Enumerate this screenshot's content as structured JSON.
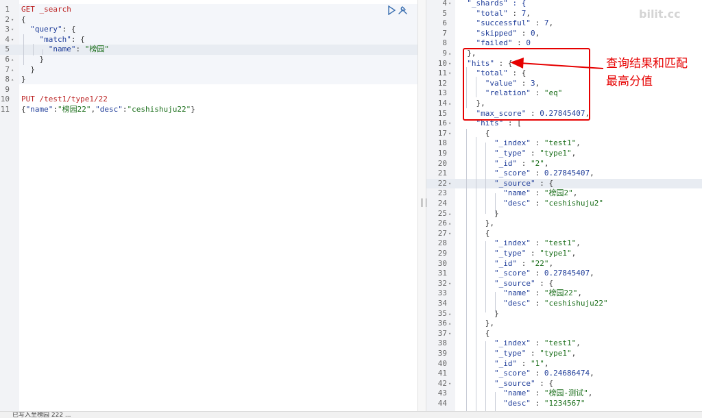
{
  "request_editor": {
    "lines": [
      {
        "n": "1",
        "fold": "",
        "segs": [
          [
            "GET _search",
            "kw"
          ]
        ]
      },
      {
        "n": "2",
        "fold": "▾",
        "segs": [
          [
            "{",
            "pun"
          ]
        ]
      },
      {
        "n": "3",
        "fold": "▾",
        "segs": [
          [
            "  ",
            "pun"
          ],
          [
            "\"query\"",
            "key"
          ],
          [
            ": {",
            "pun"
          ]
        ]
      },
      {
        "n": "4",
        "fold": "▾",
        "segs": [
          [
            "    ",
            "pun"
          ],
          [
            "\"match\"",
            "key"
          ],
          [
            ": {",
            "pun"
          ]
        ]
      },
      {
        "n": "5",
        "fold": "",
        "segs": [
          [
            "      ",
            "pun"
          ],
          [
            "\"name\"",
            "key"
          ],
          [
            ": ",
            "pun"
          ],
          [
            "\"榜园\"",
            "str"
          ]
        ]
      },
      {
        "n": "6",
        "fold": "▴",
        "segs": [
          [
            "    }",
            "pun"
          ]
        ]
      },
      {
        "n": "7",
        "fold": "▴",
        "segs": [
          [
            "  }",
            "pun"
          ]
        ]
      },
      {
        "n": "8",
        "fold": "▴",
        "segs": [
          [
            "}",
            "pun"
          ]
        ]
      },
      {
        "n": "9",
        "fold": "",
        "segs": []
      },
      {
        "n": "10",
        "fold": "",
        "segs": [
          [
            "PUT /test1/type1/22",
            "kw"
          ]
        ]
      },
      {
        "n": "11",
        "fold": "",
        "segs": [
          [
            "{",
            "pun"
          ],
          [
            "\"name\"",
            "key"
          ],
          [
            ":",
            "pun"
          ],
          [
            "\"榜园22\"",
            "str"
          ],
          [
            ",",
            "pun"
          ],
          [
            "\"desc\"",
            "key"
          ],
          [
            ":",
            "pun"
          ],
          [
            "\"ceshishuju22\"",
            "str"
          ],
          [
            "}",
            "pun"
          ]
        ]
      }
    ]
  },
  "actions": {
    "run_icon": "play-icon",
    "settings_icon": "wrench-icon"
  },
  "divider": {
    "glyph": "||"
  },
  "response_viewer": {
    "lines": [
      {
        "n": "4",
        "fold": "▾",
        "segs": [
          [
            "  \"_shards\" : {",
            "key"
          ]
        ]
      },
      {
        "n": "5",
        "fold": "",
        "segs": [
          [
            "    ",
            "pun"
          ],
          [
            "\"total\"",
            "key"
          ],
          [
            " : ",
            "pun"
          ],
          [
            "7",
            "num"
          ],
          [
            ",",
            "pun"
          ]
        ]
      },
      {
        "n": "6",
        "fold": "",
        "segs": [
          [
            "    ",
            "pun"
          ],
          [
            "\"successful\"",
            "key"
          ],
          [
            " : ",
            "pun"
          ],
          [
            "7",
            "num"
          ],
          [
            ",",
            "pun"
          ]
        ]
      },
      {
        "n": "7",
        "fold": "",
        "segs": [
          [
            "    ",
            "pun"
          ],
          [
            "\"skipped\"",
            "key"
          ],
          [
            " : ",
            "pun"
          ],
          [
            "0",
            "num"
          ],
          [
            ",",
            "pun"
          ]
        ]
      },
      {
        "n": "8",
        "fold": "",
        "segs": [
          [
            "    ",
            "pun"
          ],
          [
            "\"failed\"",
            "key"
          ],
          [
            " : ",
            "pun"
          ],
          [
            "0",
            "num"
          ]
        ]
      },
      {
        "n": "9",
        "fold": "▴",
        "segs": [
          [
            "  },",
            "pun"
          ]
        ]
      },
      {
        "n": "10",
        "fold": "▾",
        "segs": [
          [
            "  ",
            "pun"
          ],
          [
            "\"hits\"",
            "key"
          ],
          [
            " : {",
            "pun"
          ]
        ]
      },
      {
        "n": "11",
        "fold": "▾",
        "segs": [
          [
            "    ",
            "pun"
          ],
          [
            "\"total\"",
            "key"
          ],
          [
            " : {",
            "pun"
          ]
        ]
      },
      {
        "n": "12",
        "fold": "",
        "segs": [
          [
            "      ",
            "pun"
          ],
          [
            "\"value\"",
            "key"
          ],
          [
            " : ",
            "pun"
          ],
          [
            "3",
            "num"
          ],
          [
            ",",
            "pun"
          ]
        ]
      },
      {
        "n": "13",
        "fold": "",
        "segs": [
          [
            "      ",
            "pun"
          ],
          [
            "\"relation\"",
            "key"
          ],
          [
            " : ",
            "pun"
          ],
          [
            "\"eq\"",
            "str"
          ]
        ]
      },
      {
        "n": "14",
        "fold": "▴",
        "segs": [
          [
            "    },",
            "pun"
          ]
        ]
      },
      {
        "n": "15",
        "fold": "",
        "segs": [
          [
            "    ",
            "pun"
          ],
          [
            "\"max_score\"",
            "key"
          ],
          [
            " : ",
            "pun"
          ],
          [
            "0.27845407",
            "num"
          ],
          [
            ",",
            "pun"
          ]
        ]
      },
      {
        "n": "16",
        "fold": "▾",
        "segs": [
          [
            "    ",
            "pun"
          ],
          [
            "\"hits\"",
            "key"
          ],
          [
            " : [",
            "pun"
          ]
        ]
      },
      {
        "n": "17",
        "fold": "▾",
        "segs": [
          [
            "      {",
            "pun"
          ]
        ]
      },
      {
        "n": "18",
        "fold": "",
        "segs": [
          [
            "        ",
            "pun"
          ],
          [
            "\"_index\"",
            "key"
          ],
          [
            " : ",
            "pun"
          ],
          [
            "\"test1\"",
            "str"
          ],
          [
            ",",
            "pun"
          ]
        ]
      },
      {
        "n": "19",
        "fold": "",
        "segs": [
          [
            "        ",
            "pun"
          ],
          [
            "\"_type\"",
            "key"
          ],
          [
            " : ",
            "pun"
          ],
          [
            "\"type1\"",
            "str"
          ],
          [
            ",",
            "pun"
          ]
        ]
      },
      {
        "n": "20",
        "fold": "",
        "segs": [
          [
            "        ",
            "pun"
          ],
          [
            "\"_id\"",
            "key"
          ],
          [
            " : ",
            "pun"
          ],
          [
            "\"2\"",
            "str"
          ],
          [
            ",",
            "pun"
          ]
        ]
      },
      {
        "n": "21",
        "fold": "",
        "segs": [
          [
            "        ",
            "pun"
          ],
          [
            "\"_score\"",
            "key"
          ],
          [
            " : ",
            "pun"
          ],
          [
            "0.27845407",
            "num"
          ],
          [
            ",",
            "pun"
          ]
        ]
      },
      {
        "n": "22",
        "fold": "▾",
        "segs": [
          [
            "        ",
            "pun"
          ],
          [
            "\"_source\"",
            "key"
          ],
          [
            " : {",
            "pun"
          ]
        ]
      },
      {
        "n": "23",
        "fold": "",
        "segs": [
          [
            "          ",
            "pun"
          ],
          [
            "\"name\"",
            "key"
          ],
          [
            " : ",
            "pun"
          ],
          [
            "\"榜园2\"",
            "str"
          ],
          [
            ",",
            "pun"
          ]
        ]
      },
      {
        "n": "24",
        "fold": "",
        "segs": [
          [
            "          ",
            "pun"
          ],
          [
            "\"desc\"",
            "key"
          ],
          [
            " : ",
            "pun"
          ],
          [
            "\"ceshishuju2\"",
            "str"
          ]
        ]
      },
      {
        "n": "25",
        "fold": "▴",
        "segs": [
          [
            "        }",
            "pun"
          ]
        ]
      },
      {
        "n": "26",
        "fold": "▴",
        "segs": [
          [
            "      },",
            "pun"
          ]
        ]
      },
      {
        "n": "27",
        "fold": "▾",
        "segs": [
          [
            "      {",
            "pun"
          ]
        ]
      },
      {
        "n": "28",
        "fold": "",
        "segs": [
          [
            "        ",
            "pun"
          ],
          [
            "\"_index\"",
            "key"
          ],
          [
            " : ",
            "pun"
          ],
          [
            "\"test1\"",
            "str"
          ],
          [
            ",",
            "pun"
          ]
        ]
      },
      {
        "n": "29",
        "fold": "",
        "segs": [
          [
            "        ",
            "pun"
          ],
          [
            "\"_type\"",
            "key"
          ],
          [
            " : ",
            "pun"
          ],
          [
            "\"type1\"",
            "str"
          ],
          [
            ",",
            "pun"
          ]
        ]
      },
      {
        "n": "30",
        "fold": "",
        "segs": [
          [
            "        ",
            "pun"
          ],
          [
            "\"_id\"",
            "key"
          ],
          [
            " : ",
            "pun"
          ],
          [
            "\"22\"",
            "str"
          ],
          [
            ",",
            "pun"
          ]
        ]
      },
      {
        "n": "31",
        "fold": "",
        "segs": [
          [
            "        ",
            "pun"
          ],
          [
            "\"_score\"",
            "key"
          ],
          [
            " : ",
            "pun"
          ],
          [
            "0.27845407",
            "num"
          ],
          [
            ",",
            "pun"
          ]
        ]
      },
      {
        "n": "32",
        "fold": "▾",
        "segs": [
          [
            "        ",
            "pun"
          ],
          [
            "\"_source\"",
            "key"
          ],
          [
            " : {",
            "pun"
          ]
        ]
      },
      {
        "n": "33",
        "fold": "",
        "segs": [
          [
            "          ",
            "pun"
          ],
          [
            "\"name\"",
            "key"
          ],
          [
            " : ",
            "pun"
          ],
          [
            "\"榜园22\"",
            "str"
          ],
          [
            ",",
            "pun"
          ]
        ]
      },
      {
        "n": "34",
        "fold": "",
        "segs": [
          [
            "          ",
            "pun"
          ],
          [
            "\"desc\"",
            "key"
          ],
          [
            " : ",
            "pun"
          ],
          [
            "\"ceshishuju22\"",
            "str"
          ]
        ]
      },
      {
        "n": "35",
        "fold": "▴",
        "segs": [
          [
            "        }",
            "pun"
          ]
        ]
      },
      {
        "n": "36",
        "fold": "▴",
        "segs": [
          [
            "      },",
            "pun"
          ]
        ]
      },
      {
        "n": "37",
        "fold": "▾",
        "segs": [
          [
            "      {",
            "pun"
          ]
        ]
      },
      {
        "n": "38",
        "fold": "",
        "segs": [
          [
            "        ",
            "pun"
          ],
          [
            "\"_index\"",
            "key"
          ],
          [
            " : ",
            "pun"
          ],
          [
            "\"test1\"",
            "str"
          ],
          [
            ",",
            "pun"
          ]
        ]
      },
      {
        "n": "39",
        "fold": "",
        "segs": [
          [
            "        ",
            "pun"
          ],
          [
            "\"_type\"",
            "key"
          ],
          [
            " : ",
            "pun"
          ],
          [
            "\"type1\"",
            "str"
          ],
          [
            ",",
            "pun"
          ]
        ]
      },
      {
        "n": "40",
        "fold": "",
        "segs": [
          [
            "        ",
            "pun"
          ],
          [
            "\"_id\"",
            "key"
          ],
          [
            " : ",
            "pun"
          ],
          [
            "\"1\"",
            "str"
          ],
          [
            ",",
            "pun"
          ]
        ]
      },
      {
        "n": "41",
        "fold": "",
        "segs": [
          [
            "        ",
            "pun"
          ],
          [
            "\"_score\"",
            "key"
          ],
          [
            " : ",
            "pun"
          ],
          [
            "0.24686474",
            "num"
          ],
          [
            ",",
            "pun"
          ]
        ]
      },
      {
        "n": "42",
        "fold": "▾",
        "segs": [
          [
            "        ",
            "pun"
          ],
          [
            "\"_source\"",
            "key"
          ],
          [
            " : {",
            "pun"
          ]
        ]
      },
      {
        "n": "43",
        "fold": "",
        "segs": [
          [
            "          ",
            "pun"
          ],
          [
            "\"name\"",
            "key"
          ],
          [
            " : ",
            "pun"
          ],
          [
            "\"榜园-测试\"",
            "str"
          ],
          [
            ",",
            "pun"
          ]
        ]
      },
      {
        "n": "44",
        "fold": "",
        "segs": [
          [
            "          ",
            "pun"
          ],
          [
            "\"desc\"",
            "key"
          ],
          [
            " : ",
            "pun"
          ],
          [
            "\"1234567\"",
            "str"
          ]
        ]
      }
    ]
  },
  "annotation": {
    "text": "查询结果和匹配最高分值",
    "color": "#e60000"
  },
  "watermark": "bilit.cc",
  "status_bar": {
    "text": "已写入至榜园 222 ..."
  },
  "colors": {
    "keyword": "#b22222",
    "string": "#1a6e1a",
    "key": "#1f3d99",
    "gutter": "#f2f3f6",
    "active_line": "#e8ecf2"
  }
}
